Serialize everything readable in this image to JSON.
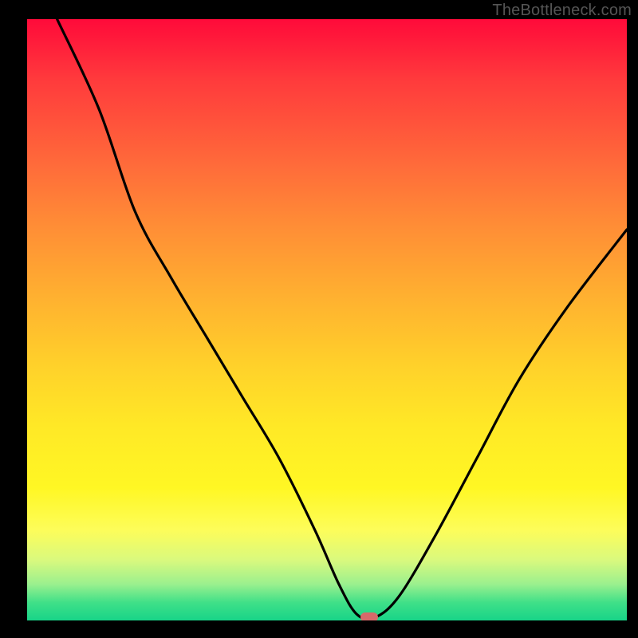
{
  "watermark": "TheBottleneck.com",
  "colors": {
    "frame": "#000000",
    "curve": "#000000",
    "marker": "#d66a6a"
  },
  "chart_data": {
    "type": "line",
    "title": "",
    "xlabel": "",
    "ylabel": "",
    "xlim": [
      0,
      100
    ],
    "ylim": [
      0,
      100
    ],
    "grid": false,
    "series": [
      {
        "name": "bottleneck-curve",
        "x": [
          5,
          12,
          18,
          24,
          30,
          36,
          42,
          48,
          52,
          55,
          58,
          62,
          68,
          75,
          82,
          90,
          100
        ],
        "y": [
          100,
          85,
          68,
          57,
          47,
          37,
          27,
          15,
          6,
          1,
          0.5,
          4,
          14,
          27,
          40,
          52,
          65
        ]
      }
    ],
    "annotations": [
      {
        "name": "optimal-marker",
        "x": 57,
        "y": 0.5
      }
    ],
    "background_gradient": {
      "top": "#ff0a3a",
      "mid": "#ffe926",
      "bottom": "#18d488",
      "meaning": "red=high bottleneck, green=no bottleneck"
    }
  }
}
